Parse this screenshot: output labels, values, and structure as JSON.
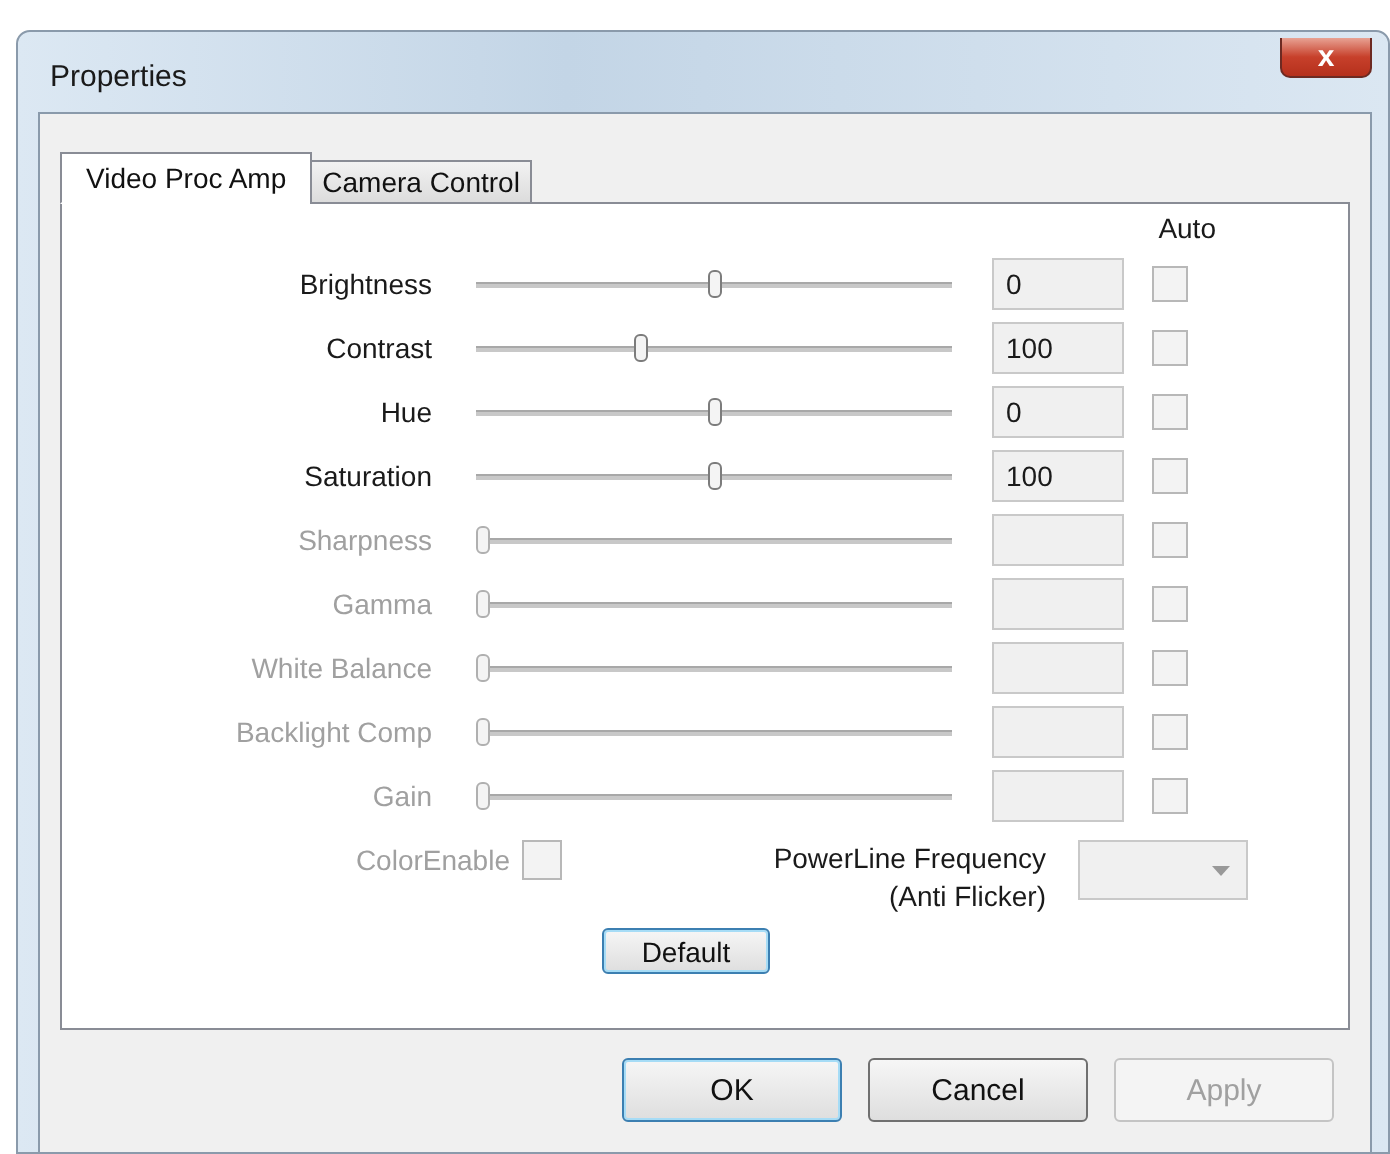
{
  "window": {
    "title": "Properties",
    "close": "x"
  },
  "tabs": [
    {
      "label": "Video Proc Amp",
      "selected": true
    },
    {
      "label": "Camera Control",
      "selected": false
    }
  ],
  "auto_header": "Auto",
  "controls": [
    {
      "label": "Brightness",
      "level": 0.5,
      "value": "0",
      "disabled": false,
      "auto": false
    },
    {
      "label": "Contrast",
      "level": 0.34,
      "value": "100",
      "disabled": false,
      "auto": false
    },
    {
      "label": "Hue",
      "level": 0.5,
      "value": "0",
      "disabled": false,
      "auto": false
    },
    {
      "label": "Saturation",
      "level": 0.5,
      "value": "100",
      "disabled": false,
      "auto": false
    },
    {
      "label": "Sharpness",
      "level": 0,
      "disabled": true,
      "auto": false
    },
    {
      "label": "Gamma",
      "level": 0,
      "disabled": true,
      "auto": false
    },
    {
      "label": "White Balance",
      "level": 0,
      "disabled": true,
      "auto": false
    },
    {
      "label": "Backlight Comp",
      "level": 0,
      "disabled": true,
      "auto": false
    },
    {
      "label": "Gain",
      "level": 0,
      "disabled": true,
      "auto": false
    }
  ],
  "color_enable": {
    "label": "ColorEnable",
    "checked": false
  },
  "powerline": {
    "label": "PowerLine Frequency",
    "sublabel": "(Anti Flicker)",
    "disabled": true
  },
  "default_button": {
    "label": "Default",
    "highlighted": true,
    "disabled": false
  },
  "buttons": [
    {
      "label": "OK",
      "highlighted": true,
      "disabled": false
    },
    {
      "label": "Cancel",
      "highlighted": false,
      "disabled": false
    },
    {
      "label": "Apply",
      "highlighted": false,
      "disabled": true
    }
  ]
}
